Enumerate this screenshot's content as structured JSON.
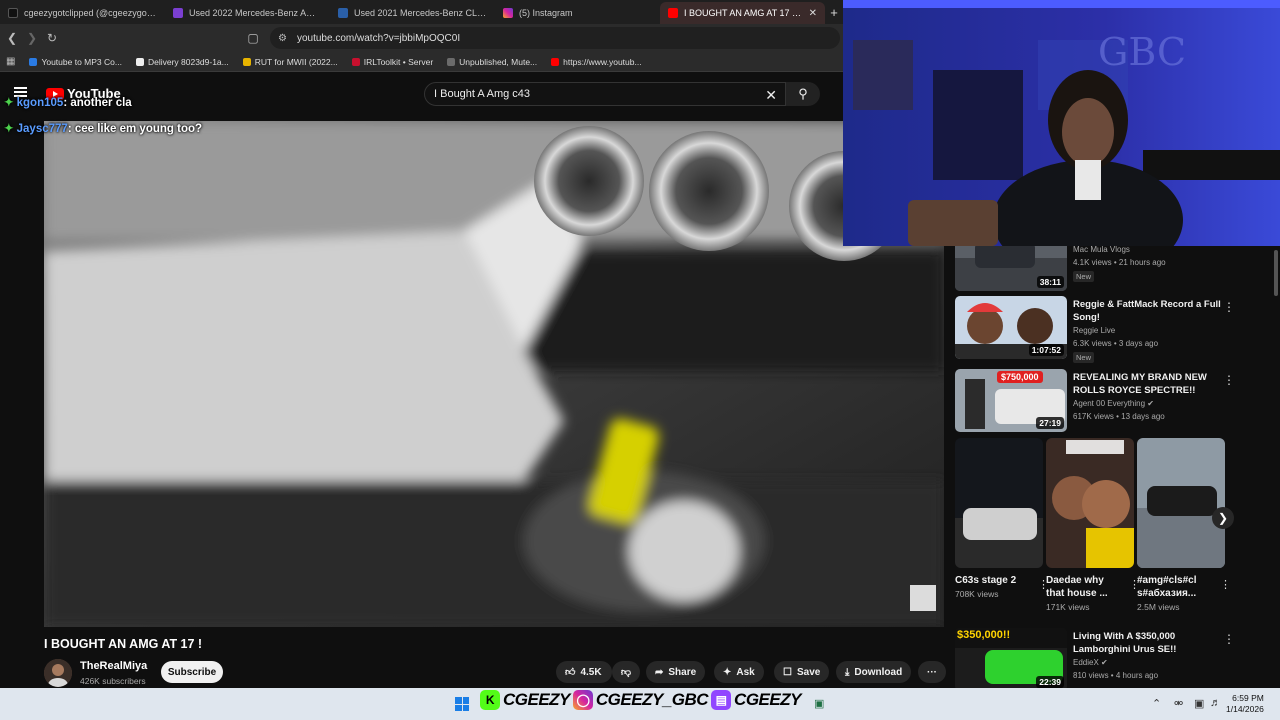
{
  "tabs": [
    {
      "title": "cgeezygotclipped (@cgeezygotclipp...",
      "color": "#111111",
      "active": false
    },
    {
      "title": "Used 2022 Mercedes-Benz AMG CLA...",
      "color": "#7b3fd1",
      "active": false
    },
    {
      "title": "Used 2021 Mercedes-Benz CLA45 AM...",
      "color": "#2a5fa8",
      "active": false
    },
    {
      "title": "(5) Instagram",
      "color": "#d6249f",
      "active": false
    },
    {
      "title": "I BOUGHT AN AMG AT 17 ! - ...",
      "color": "#ff0000",
      "active": true
    }
  ],
  "new_tab_label": "+",
  "address": {
    "url": "youtube.com/watch?v=jbbiMpOQC0I"
  },
  "bookmarks": [
    {
      "label": "Youtube to MP3 Co...",
      "color": "#2a7be4"
    },
    {
      "label": "Delivery 8023d9-1a...",
      "color": "#eeeeee"
    },
    {
      "label": "RUT for MWII (2022...",
      "color": "#e8b400"
    },
    {
      "label": "IRLToolkit • Server",
      "color": "#c8102e"
    },
    {
      "label": "Unpublished, Mute...",
      "color": "#6b6b6b"
    },
    {
      "label": "https://www.youtub...",
      "color": "#ff0000"
    }
  ],
  "youtube": {
    "logo_text": "YouTube",
    "search_query": "I Bought A Amg c43"
  },
  "chat": [
    {
      "user": "kgon105",
      "message": "another cla"
    },
    {
      "user": "Jaysc777",
      "message": "cee like em young too?"
    }
  ],
  "video": {
    "title": "I BOUGHT AN AMG AT 17 !",
    "channel": "TheRealMiya",
    "subscribers": "426K subscribers",
    "subscribe_label": "Subscribe",
    "likes": "4.5K",
    "share_label": "Share",
    "ask_label": "Ask",
    "save_label": "Save",
    "download_label": "Download",
    "more_label": "···"
  },
  "recommendations": [
    {
      "title": "",
      "channel": "Mac Mula Vlogs",
      "meta": "4.1K views • 21 hours ago",
      "new": "New",
      "duration": "38:11"
    },
    {
      "title": "Reggie & FattMack Record a Full Song!",
      "channel": "Reggie Live",
      "meta": "6.3K views • 3 days ago",
      "new": "New",
      "duration": "1:07:52"
    },
    {
      "title": "REVEALING MY BRAND NEW ROLLS ROYCE SPECTRE!!",
      "channel": "Agent 00 Everything",
      "meta": "617K views • 13 days ago",
      "new": "",
      "duration": "27:19",
      "thumb_badge": "$750,000"
    },
    {
      "title": "Living With A $350,000 Lamborghini Urus SE!!",
      "channel": "EddieX",
      "meta": "810 views • 4 hours ago",
      "new": "",
      "duration": "22:39",
      "thumb_badge": "$350,000!!"
    }
  ],
  "shorts": [
    {
      "title": "C63s stage 2",
      "views": "708K views"
    },
    {
      "title": "Daedae why that house ...",
      "views": "171K views"
    },
    {
      "title": "#amg#cls#cl s#абхазия...",
      "views": "2.5M views"
    }
  ],
  "taskbar": {
    "banner_1": "CGEEZY",
    "banner_2": "CGEEZY_GBC",
    "banner_3": "CGEEZY",
    "time": "6:59 PM",
    "date": "1/14/2026"
  },
  "webcam": {
    "wall_text": "GBC"
  }
}
